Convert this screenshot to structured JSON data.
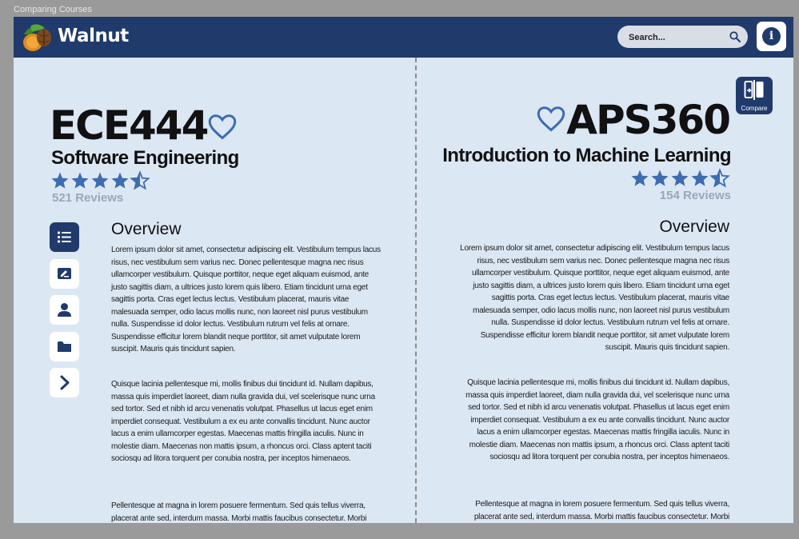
{
  "window_title": "Comparing Courses",
  "header": {
    "app_name": "Walnut",
    "search_placeholder": "Search...",
    "info_icon": "info-icon"
  },
  "compare_button": {
    "label": "Compare",
    "icon": "compare-icon"
  },
  "sidebar": {
    "items": [
      {
        "name": "overview",
        "icon": "list-icon",
        "active": true
      },
      {
        "name": "reviews",
        "icon": "edit-review-icon",
        "active": false
      },
      {
        "name": "instructors",
        "icon": "person-icon",
        "active": false
      },
      {
        "name": "resources",
        "icon": "folder-icon",
        "active": false
      },
      {
        "name": "next",
        "icon": "chevron-right-icon",
        "active": false
      }
    ]
  },
  "left_course": {
    "code": "ECE444",
    "name": "Software Engineering",
    "rating": 4.5,
    "max_rating": 5,
    "reviews": "521 Reviews",
    "overview_title": "Overview",
    "paragraphs": [
      "Lorem ipsum dolor sit amet, consectetur adipiscing elit. Vestibulum tempus lacus risus, nec vestibulum sem varius nec. Donec pellentesque magna nec risus ullamcorper vestibulum. Quisque porttitor, neque eget aliquam euismod, ante justo sagittis diam, a ultrices justo lorem quis libero. Etiam tincidunt urna eget sagittis porta. Cras eget lectus lectus. Vestibulum placerat, mauris vitae malesuada semper, odio lacus mollis nunc, non laoreet nisl purus vestibulum nulla. Suspendisse id dolor lectus. Vestibulum rutrum vel felis at ornare. Suspendisse efficitur lorem blandit neque porttitor, sit amet vulputate lorem suscipit. Mauris quis tincidunt sapien.",
      "Quisque lacinia pellentesque mi, mollis finibus dui tincidunt id. Nullam dapibus, massa quis imperdiet laoreet, diam nulla gravida dui, vel scelerisque nunc urna sed tortor. Sed et nibh id arcu venenatis volutpat. Phasellus ut lacus eget enim imperdiet consequat. Vestibulum a ex eu ante convallis tincidunt. Nunc auctor lacus a enim ullamcorper egestas. Maecenas mattis fringilla iaculis. Nunc in molestie diam. Maecenas non mattis ipsum, a rhoncus orci. Class aptent taciti sociosqu ad litora torquent per conubia nostra, per inceptos himenaeos.",
      "Pellentesque at magna in lorem posuere fermentum. Sed quis tellus viverra, placerat ante sed, interdum massa. Morbi mattis faucibus consectetur. Morbi"
    ]
  },
  "right_course": {
    "code": "APS360",
    "name": "Introduction to Machine Learning",
    "rating": 4.5,
    "max_rating": 5,
    "reviews": "154 Reviews",
    "overview_title": "Overview",
    "paragraphs": [
      "Lorem ipsum dolor sit amet, consectetur adipiscing elit. Vestibulum tempus lacus risus, nec vestibulum sem varius nec. Donec pellentesque magna nec risus ullamcorper vestibulum. Quisque porttitor, neque eget aliquam euismod, ante justo sagittis diam, a ultrices justo lorem quis libero. Etiam tincidunt urna eget sagittis porta. Cras eget lectus lectus. Vestibulum placerat, mauris vitae malesuada semper, odio lacus mollis nunc, non laoreet nisl purus vestibulum nulla. Suspendisse id dolor lectus. Vestibulum rutrum vel felis at ornare. Suspendisse efficitur lorem blandit neque porttitor, sit amet vulputate lorem suscipit. Mauris quis tincidunt sapien.",
      "Quisque lacinia pellentesque mi, mollis finibus dui tincidunt id. Nullam dapibus, massa quis imperdiet laoreet, diam nulla gravida dui, vel scelerisque nunc urna sed tortor. Sed et nibh id arcu venenatis volutpat. Phasellus ut lacus eget enim imperdiet consequat. Vestibulum a ex eu ante convallis tincidunt. Nunc auctor lacus a enim ullamcorper egestas. Maecenas mattis fringilla iaculis. Nunc in molestie diam. Maecenas non mattis ipsum, a rhoncus orci. Class aptent taciti sociosqu ad litora torquent per conubia nostra, per inceptos himenaeos.",
      "Pellentesque at magna in lorem posuere fermentum. Sed quis tellus viverra, placerat ante sed, interdum massa. Morbi mattis faucibus consectetur. Morbi"
    ]
  },
  "colors": {
    "primary": "#1f3a6b",
    "background": "#dce7f4",
    "star": "#3d6cb0",
    "heart": "#3d6cb0",
    "muted": "#9aa7b8"
  }
}
